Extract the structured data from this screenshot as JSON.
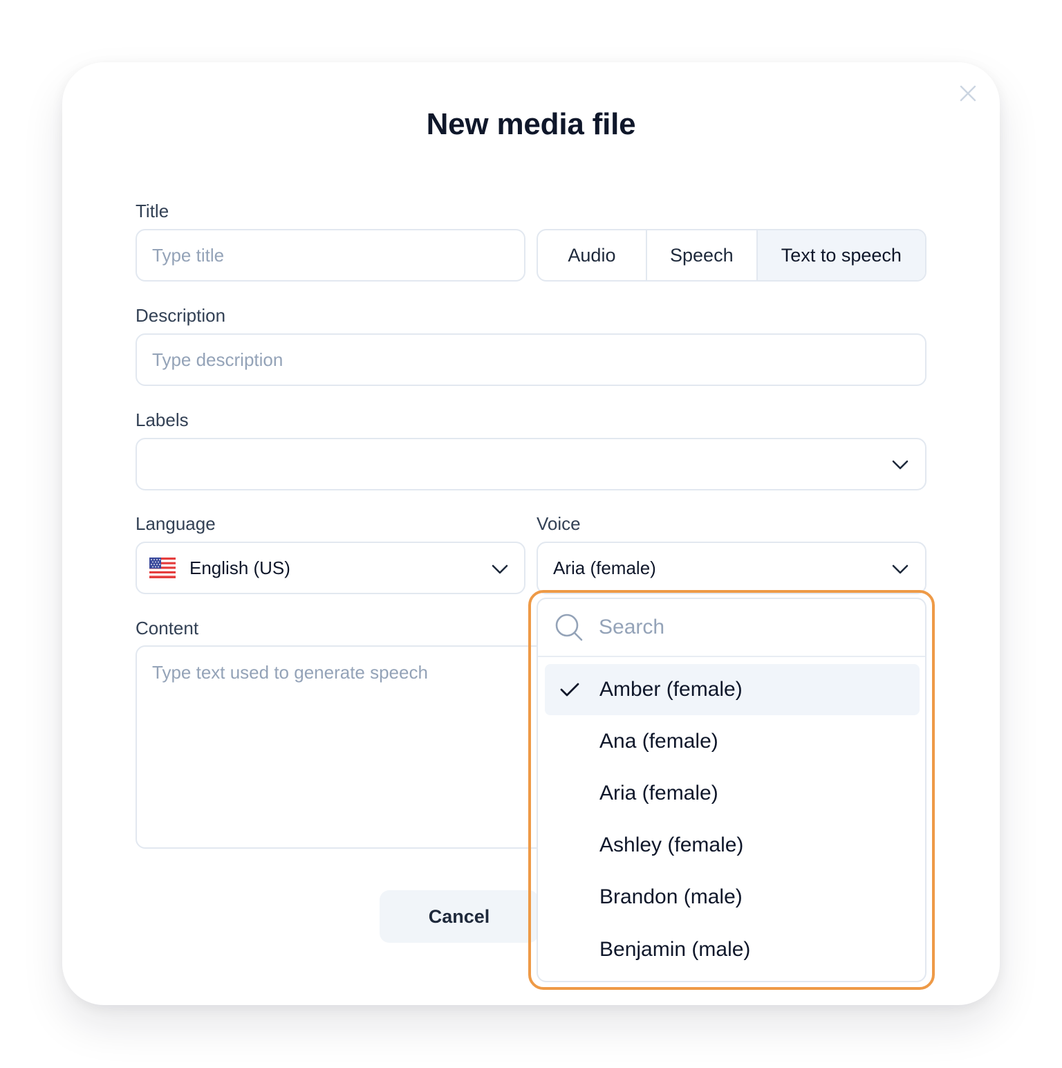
{
  "modal": {
    "title": "New media file"
  },
  "form": {
    "title_label": "Title",
    "title_placeholder": "Type title",
    "type_tabs": [
      {
        "label": "Audio",
        "active": false
      },
      {
        "label": "Speech",
        "active": false
      },
      {
        "label": "Text to speech",
        "active": true
      }
    ],
    "description_label": "Description",
    "description_placeholder": "Type description",
    "labels_label": "Labels",
    "labels_value": "",
    "language_label": "Language",
    "language_value": "English (US)",
    "language_flag_icon": "us-flag-icon",
    "voice_label": "Voice",
    "voice_value": "Aria (female)",
    "content_label": "Content",
    "content_placeholder": "Type text used to generate speech",
    "cancel_label": "Cancel"
  },
  "voice_dropdown": {
    "search_placeholder": "Search",
    "selected_index": 0,
    "options": [
      "Amber (female)",
      "Ana (female)",
      "Aria (female)",
      "Ashley (female)",
      "Brandon (male)",
      "Benjamin (male)"
    ]
  },
  "colors": {
    "highlight": "#ee9a47",
    "border": "#e2e8f0",
    "text": "#0f172a",
    "placeholder": "#94a3b8",
    "active_tab_bg": "#f1f5fa"
  }
}
